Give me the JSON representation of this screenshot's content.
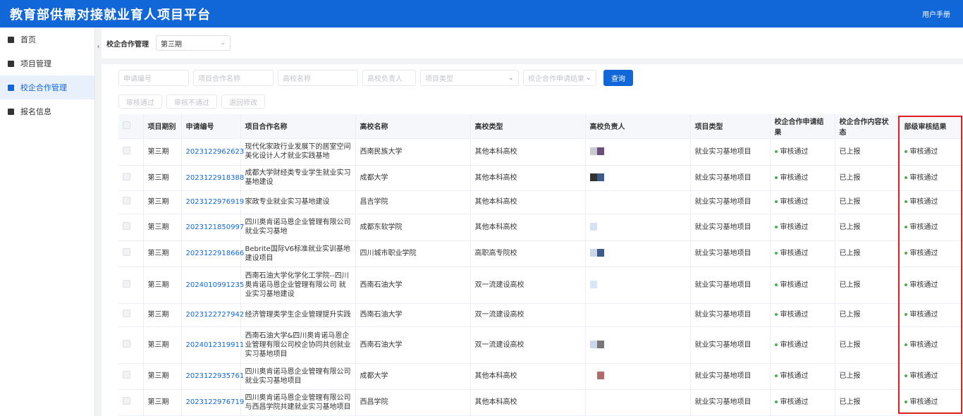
{
  "header": {
    "title": "教育部供需对接就业育人项目平台",
    "manual": "用户手册"
  },
  "sidebar": {
    "items": [
      {
        "label": "首页",
        "icon": "home-icon",
        "active": false
      },
      {
        "label": "项目管理",
        "icon": "project-icon",
        "active": false
      },
      {
        "label": "校企合作管理",
        "icon": "cooperation-icon",
        "active": true
      },
      {
        "label": "报名信息",
        "icon": "signup-icon",
        "active": false
      }
    ]
  },
  "topbar": {
    "label": "校企合作管理",
    "period": "第三期"
  },
  "filters": {
    "app_no": "申请编号",
    "project_name": "项目合作名称",
    "school_name": "高校名称",
    "school_contact": "高校负责人",
    "project_type": "项目类型",
    "coop_result": "校企合作申请结果",
    "query": "查询"
  },
  "actions": {
    "approve": "审核通过",
    "reject": "审核不通过",
    "return": "退回修改"
  },
  "table": {
    "headers": [
      "项目期别",
      "申请编号",
      "项目合作名称",
      "高校名称",
      "高校类型",
      "高校负责人",
      "项目类型",
      "校企合作申请结果",
      "校企合作内容状态",
      "部级审核结果"
    ],
    "rows": [
      {
        "period": "第三期",
        "code": "2023122962623",
        "name": "现代化家政行业发展下的居室空间美化设计人才就业实践基地",
        "school": "西南民族大学",
        "type": "其他本科高校",
        "ptype": "就业实习基地项目",
        "apply": "审核通过",
        "status": "已上报",
        "review": "审核通过"
      },
      {
        "period": "第三期",
        "code": "2023122918388",
        "name": "成都大学财经类专业学生就业实习基地建设",
        "school": "成都大学",
        "type": "其他本科高校",
        "ptype": "就业实习基地项目",
        "apply": "审核通过",
        "status": "已上报",
        "review": "审核通过"
      },
      {
        "period": "第三期",
        "code": "2023122976919",
        "name": "家政专业就业实习基地建设",
        "school": "昌吉学院",
        "type": "其他本科高校",
        "ptype": "就业实习基地项目",
        "apply": "审核通过",
        "status": "已上报",
        "review": "审核通过"
      },
      {
        "period": "第三期",
        "code": "2023121850997",
        "name": "四川奥肯诺马恩企业管理有限公司就业实习基地",
        "school": "成都东软学院",
        "type": "其他本科高校",
        "ptype": "就业实习基地项目",
        "apply": "审核通过",
        "status": "已上报",
        "review": "审核通过"
      },
      {
        "period": "第三期",
        "code": "2023122918666",
        "name": "Bebrite国际V6标准就业实训基地建设项目",
        "school": "四川城市职业学院",
        "type": "高职高专院校",
        "ptype": "就业实习基地项目",
        "apply": "审核通过",
        "status": "已上报",
        "review": "审核通过"
      },
      {
        "period": "第三期",
        "code": "2024010991235",
        "name": "西南石油大学化学化工学院--四川奥肯诺马恩企业管理有限公司 就业实习基地建设",
        "school": "西南石油大学",
        "type": "双一流建设高校",
        "ptype": "就业实习基地项目",
        "apply": "审核通过",
        "status": "已上报",
        "review": "审核通过"
      },
      {
        "period": "第三期",
        "code": "2023122727942",
        "name": "经济管理类学生企业管理提升实践",
        "school": "西南石油大学",
        "type": "双一流建设高校",
        "ptype": "就业实习基地项目",
        "apply": "审核通过",
        "status": "已上报",
        "review": "审核通过"
      },
      {
        "period": "第三期",
        "code": "2024012319911",
        "name": "西南石油大学&四川奥肯诺马恩企业管理有限公司校企协同共创就业实习基地项目",
        "school": "西南石油大学",
        "type": "双一流建设高校",
        "ptype": "就业实习基地项目",
        "apply": "审核通过",
        "status": "已上报",
        "review": "审核通过"
      },
      {
        "period": "第三期",
        "code": "2023122935761",
        "name": "四川奥肯诺马恩企业管理有限公司就业实习基地项目",
        "school": "成都大学",
        "type": "其他本科高校",
        "ptype": "就业实习基地项目",
        "apply": "审核通过",
        "status": "已上报",
        "review": "审核通过"
      },
      {
        "period": "第三期",
        "code": "2023122976719",
        "name": "四川奥肯诺马恩企业管理有限公司与西昌学院共建就业实习基地项目",
        "school": "西昌学院",
        "type": "其他本科高校",
        "ptype": "就业实习基地项目",
        "apply": "审核通过",
        "status": "已上报",
        "review": "审核通过"
      }
    ]
  },
  "colors": {
    "primary": "#1267d8",
    "success_dot": "#4caf50",
    "highlight": "#e02020"
  }
}
